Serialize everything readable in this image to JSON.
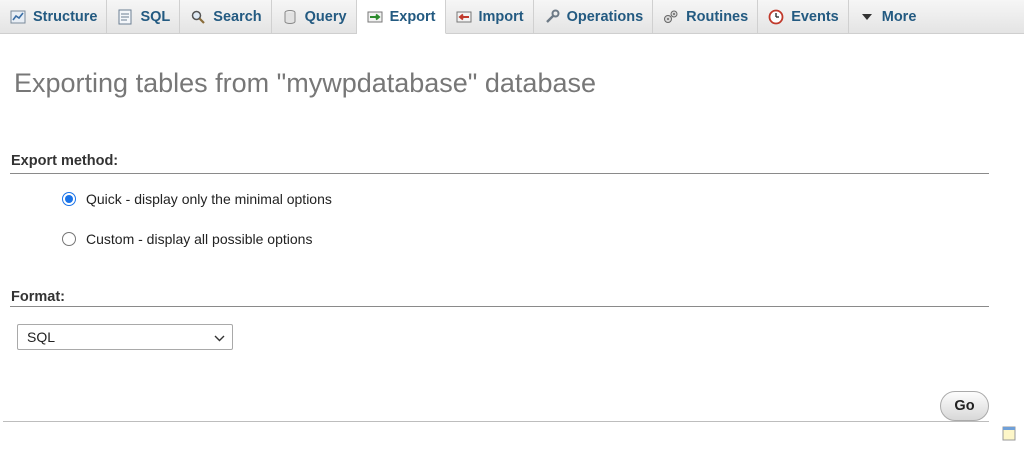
{
  "tabs": [
    {
      "label": "Structure",
      "icon": "structure-icon"
    },
    {
      "label": "SQL",
      "icon": "sql-icon"
    },
    {
      "label": "Search",
      "icon": "search-icon"
    },
    {
      "label": "Query",
      "icon": "query-icon"
    },
    {
      "label": "Export",
      "icon": "export-icon",
      "active": true
    },
    {
      "label": "Import",
      "icon": "import-icon"
    },
    {
      "label": "Operations",
      "icon": "wrench-icon"
    },
    {
      "label": "Routines",
      "icon": "routines-icon"
    },
    {
      "label": "Events",
      "icon": "clock-icon"
    },
    {
      "label": "More",
      "icon": "triangle-down-icon"
    }
  ],
  "page": {
    "title": "Exporting tables from \"mywpdatabase\" database"
  },
  "export_method": {
    "label": "Export method:",
    "options": [
      {
        "label": "Quick - display only the minimal options",
        "checked": true
      },
      {
        "label": "Custom - display all possible options",
        "checked": false
      }
    ]
  },
  "format": {
    "label": "Format:",
    "selected": "SQL"
  },
  "actions": {
    "go_label": "Go"
  },
  "colors": {
    "tab_text": "#235a81",
    "radio_accent": "#1a73e8",
    "title_text": "#777777"
  }
}
